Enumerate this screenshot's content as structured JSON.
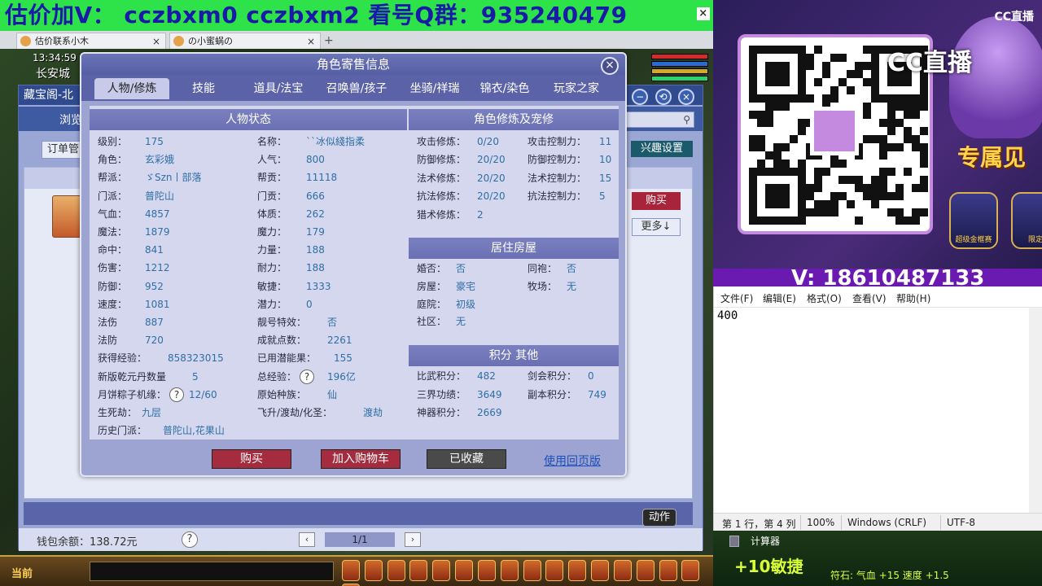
{
  "banner": {
    "text": "估价加V：  cczbxm0   cczbxm2   看号Q群：935240479",
    "close": "×"
  },
  "browser_tabs": [
    {
      "label": "估价联系小木",
      "close": "×"
    },
    {
      "label": "の小蜜蜗の",
      "close": "×"
    }
  ],
  "tab_add": "+",
  "hud": {
    "time": "13:34:59",
    "city": "长安城"
  },
  "cbg": {
    "title": "藏宝阁-北",
    "browse": "浏览",
    "order": "订单管",
    "interest": "兴趣设置",
    "buy": "购买",
    "more": "更多↓",
    "wallet": "钱包余额：138.72元",
    "help": "?",
    "page": "1/1",
    "prev": "‹",
    "next": "›",
    "action": "动作",
    "win_min": "−",
    "win_restore": "⟲",
    "win_close": "×"
  },
  "gamebar": {
    "current": "当前"
  },
  "modal": {
    "title": "角色寄售信息",
    "close": "×",
    "tabs": [
      "人物/修炼",
      "技能",
      "道具/法宝",
      "召唤兽/孩子",
      "坐骑/祥瑞",
      "锦衣/染色",
      "玩家之家"
    ],
    "section_status": "人物状态",
    "section_cultivation": "角色修炼及宠修",
    "section_house": "居住房屋",
    "section_score": "积分 其他",
    "status_left": [
      {
        "k": "级别：",
        "v": "175"
      },
      {
        "k": "角色：",
        "v": "玄彩娥"
      },
      {
        "k": "帮派：",
        "v": "ゞSzn丨部落"
      },
      {
        "k": "门派：",
        "v": "普陀山"
      },
      {
        "k": "气血：",
        "v": "4857"
      },
      {
        "k": "魔法：",
        "v": "1879"
      },
      {
        "k": "命中：",
        "v": "841"
      },
      {
        "k": "伤害：",
        "v": "1212"
      },
      {
        "k": "防御：",
        "v": "952"
      },
      {
        "k": "速度：",
        "v": "1081"
      },
      {
        "k": "法伤",
        "v": "887"
      },
      {
        "k": "法防",
        "v": "720"
      },
      {
        "k": "获得经验：",
        "v": "858323015"
      },
      {
        "k": "新版乾元丹数量",
        "v": "5"
      },
      {
        "k": "月饼粽子机缘：",
        "v": "12/60"
      },
      {
        "k": "生死劫：",
        "v": "九层"
      },
      {
        "k": "历史门派：",
        "v": "普陀山,花果山"
      }
    ],
    "status_right": [
      {
        "k": "名称：",
        "v": "``冰似綫指柔"
      },
      {
        "k": "人气：",
        "v": "800"
      },
      {
        "k": "帮贡：",
        "v": "11118"
      },
      {
        "k": "门贡：",
        "v": "666"
      },
      {
        "k": "体质：",
        "v": "262"
      },
      {
        "k": "魔力：",
        "v": "179"
      },
      {
        "k": "力量：",
        "v": "188"
      },
      {
        "k": "耐力：",
        "v": "188"
      },
      {
        "k": "敏捷：",
        "v": "1333"
      },
      {
        "k": "潜力：",
        "v": "0"
      },
      {
        "k": "靓号特效：",
        "v": "否"
      },
      {
        "k": "成就点数：",
        "v": "2261"
      },
      {
        "k": "已用潜能果：",
        "v": "155"
      },
      {
        "k": "总经验：",
        "v": "196亿"
      },
      {
        "k": "原始种族：",
        "v": "仙"
      },
      {
        "k": "飞升/渡劫/化圣：",
        "v": "渡劫"
      }
    ],
    "cultivation": [
      {
        "k": "攻击修炼：",
        "v": "0/20",
        "k2": "攻击控制力：",
        "v2": "11"
      },
      {
        "k": "防御修炼：",
        "v": "20/20",
        "k2": "防御控制力：",
        "v2": "10"
      },
      {
        "k": "法术修炼：",
        "v": "20/20",
        "k2": "法术控制力：",
        "v2": "15"
      },
      {
        "k": "抗法修炼：",
        "v": "20/20",
        "k2": "抗法控制力：",
        "v2": "5"
      },
      {
        "k": "猎术修炼：",
        "v": "2",
        "k2": "",
        "v2": ""
      }
    ],
    "house": [
      {
        "k": "婚否：",
        "v": "否",
        "k2": "同袍：",
        "v2": "否"
      },
      {
        "k": "房屋：",
        "v": "豪宅",
        "k2": "牧场：",
        "v2": "无"
      },
      {
        "k": "庭院：",
        "v": "初级",
        "k2": "",
        "v2": ""
      },
      {
        "k": "社区：",
        "v": "无",
        "k2": "",
        "v2": ""
      }
    ],
    "score": [
      {
        "k": "比武积分：",
        "v": "482",
        "k2": "剑会积分：",
        "v2": "0"
      },
      {
        "k": "三界功绩：",
        "v": "3649",
        "k2": "副本积分：",
        "v2": "749"
      },
      {
        "k": "神器积分：",
        "v": "2669",
        "k2": "",
        "v2": ""
      }
    ],
    "help": "?",
    "btn_buy": "购买",
    "btn_cart": "加入购物车",
    "btn_fav": "已收藏",
    "link_old": "使用回页版"
  },
  "stream": {
    "cc_logo": "CC直播",
    "cc_zhibo": "CC直播",
    "zhuanshu": "专属见",
    "badge1": "超级金框赛",
    "badge2": "限定",
    "bottom": "V: 18610487133"
  },
  "notepad": {
    "menu": [
      "文件(F)",
      "编辑(E)",
      "格式(O)",
      "查看(V)",
      "帮助(H)"
    ],
    "text": "400",
    "status": [
      "第 1 行，第 4 列",
      "100%",
      "Windows (CRLF)",
      "UTF-8"
    ]
  },
  "taskbar": {
    "calc": "计算器",
    "stat1": "+10敏捷",
    "stat2": "符石: 气血 +15 速度 +1.5"
  },
  "colors": {
    "banner_bg": "#2ee34a",
    "banner_text": "#1a1aa8",
    "modal_bg": "#9da4d2",
    "value_blue": "#2f6fa4",
    "buy_red": "#a52c3e"
  }
}
